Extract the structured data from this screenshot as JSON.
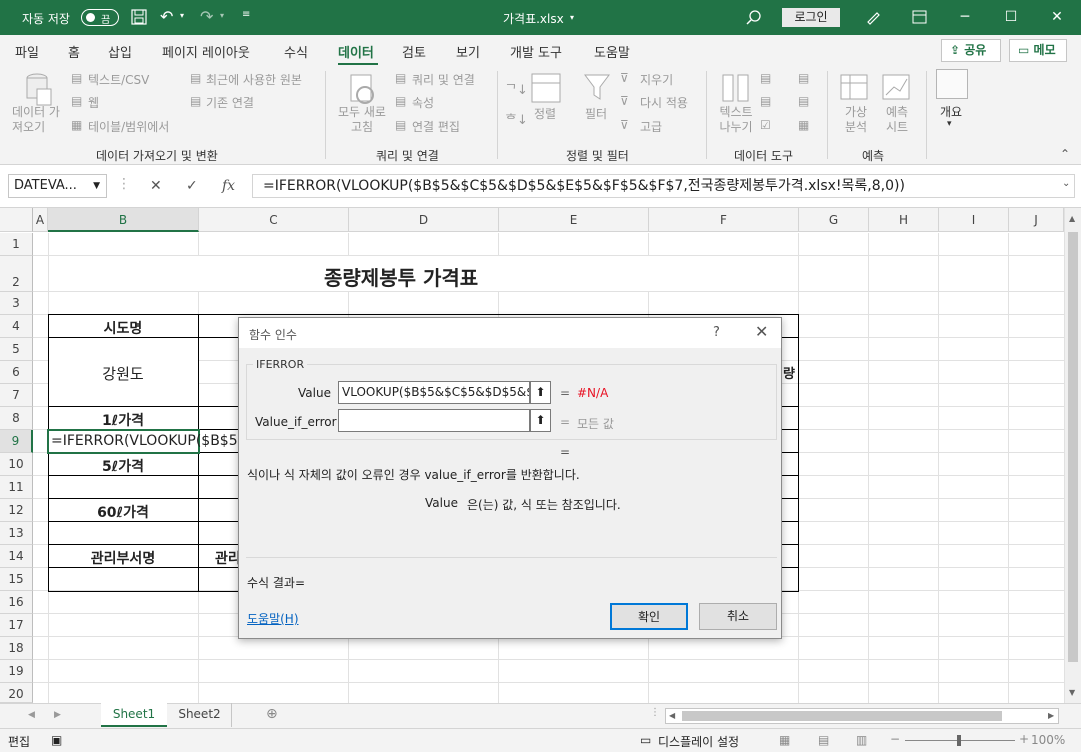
{
  "titlebar": {
    "autosave_label": "자동 저장",
    "autosave_state": "끔",
    "doc_title": "가격표.xlsx",
    "login_label": "로그인"
  },
  "tabs": [
    "파일",
    "홈",
    "삽입",
    "페이지 레이아웃",
    "수식",
    "데이터",
    "검토",
    "보기",
    "개발 도구",
    "도움말"
  ],
  "active_tab": "데이터",
  "header_buttons": {
    "share": "공유",
    "comment": "메모"
  },
  "ribbon": {
    "get_data": "데이터 가져오기",
    "from_text_csv": "텍스트/CSV",
    "from_web": "웹",
    "from_table": "테이블/범위에서",
    "recent_sources": "최근에 사용한 원본",
    "existing_connections": "기존 연결",
    "group_get": "데이터 가져오기 및 변환",
    "refresh_all": "모두 새로 고침",
    "queries_connections": "쿼리 및 연결",
    "properties": "속성",
    "edit_links": "연결 편집",
    "group_queries": "쿼리 및 연결",
    "sort": "정렬",
    "filter": "필터",
    "clear": "지우기",
    "reapply": "다시 적용",
    "advanced": "고급",
    "group_sort": "정렬 및 필터",
    "text_to_columns": "텍스트 나누기",
    "group_tools": "데이터 도구",
    "what_if": "가상 분석",
    "forecast_sheet": "예측 시트",
    "group_forecast": "예측",
    "outline": "개요"
  },
  "formula_bar": {
    "name_box": "DATEVA...",
    "formula": "=IFERROR(VLOOKUP($B$5&$C$5&$D$5&$E$5&$F$5&$F$7,전국종량제봉투가격.xlsx!목록,8,0))"
  },
  "columns": [
    "A",
    "B",
    "C",
    "D",
    "E",
    "F",
    "G",
    "H",
    "I",
    "J"
  ],
  "rows": [
    "1",
    "2",
    "3",
    "4",
    "5",
    "6",
    "7",
    "8",
    "9",
    "10",
    "11",
    "12",
    "13",
    "14",
    "15",
    "16",
    "17",
    "18",
    "19",
    "20"
  ],
  "cells": {
    "title": "종량제봉투 가격표",
    "b4": "시도명",
    "b5": "강원도",
    "b8": "1ℓ가격",
    "b9": "=IFERROR(VLOOKUP($B$5&",
    "b10": "5ℓ가격",
    "b12": "60ℓ가격",
    "b14": "관리부서명",
    "c14": "관리",
    "f6_frag": "량"
  },
  "dialog": {
    "title": "함수 인수",
    "help_q": "?",
    "func_name": "IFERROR",
    "arg1_label": "Value",
    "arg1_value": "VLOOKUP($B$5&$C$5&$D$5&$E$5&",
    "arg1_result": "#N/A",
    "arg2_label": "Value_if_error",
    "arg2_value": "",
    "arg2_result": "모든 값",
    "eq": "=",
    "description": "식이나 식 자체의 값이 오류인 경우 value_if_error를 반환합니다.",
    "arg_desc_name": "Value",
    "arg_desc_text": "은(는) 값, 식 또는 참조입니다.",
    "formula_result_label": "수식 결과=",
    "help_link": "도움말(H)",
    "ok": "확인",
    "cancel": "취소"
  },
  "sheets": [
    "Sheet1",
    "Sheet2"
  ],
  "active_sheet": "Sheet1",
  "status": {
    "mode": "편집",
    "display_settings": "디스플레이 설정",
    "zoom": "100%"
  },
  "colors": {
    "excel_green": "#217346",
    "error_red": "#e81123",
    "link_blue": "#0563c1"
  }
}
